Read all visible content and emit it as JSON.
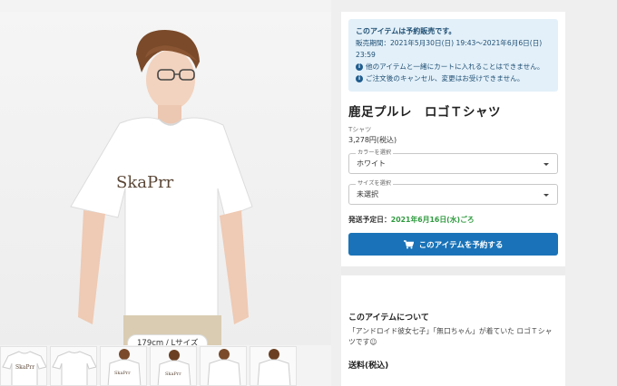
{
  "product": {
    "photo_badge": "179cm / Lサイズ",
    "thumbnail_count": 6,
    "notice": {
      "title": "このアイテムは予約販売です。",
      "period": "販売期間：2021年5月30日(日) 19:43〜2021年6月6日(日) 23:59",
      "info1": "他のアイテムと一緒にカートに入れることはできません。",
      "info2": "ご注文後のキャンセル、変更はお受けできません。"
    },
    "title": "鹿足プルレ　ロゴＴシャツ",
    "category": "Tシャツ",
    "price": "3,278円(税込)",
    "color_select": {
      "legend": "カラーを選択",
      "value": "ホワイト"
    },
    "size_select": {
      "legend": "サイズを選択",
      "value": "未選択"
    },
    "shipping_label": "発送予定日：",
    "shipping_date": "2021年6月16日(水)ごろ",
    "reserve_button": "このアイテムを予約する",
    "about_title": "このアイテムについて",
    "about_text": "「アンドロイド彼女七子」「無口ちゃん」が着ていた ロゴＴシャツです☺",
    "shipping_section_title": "送料(税込)",
    "logo_text": "SkaPrr"
  },
  "colors": {
    "notice_bg": "#e3f0f9",
    "notice_text": "#1f4f74",
    "button": "#1a73b8",
    "ship_date": "#2e9a3e"
  }
}
